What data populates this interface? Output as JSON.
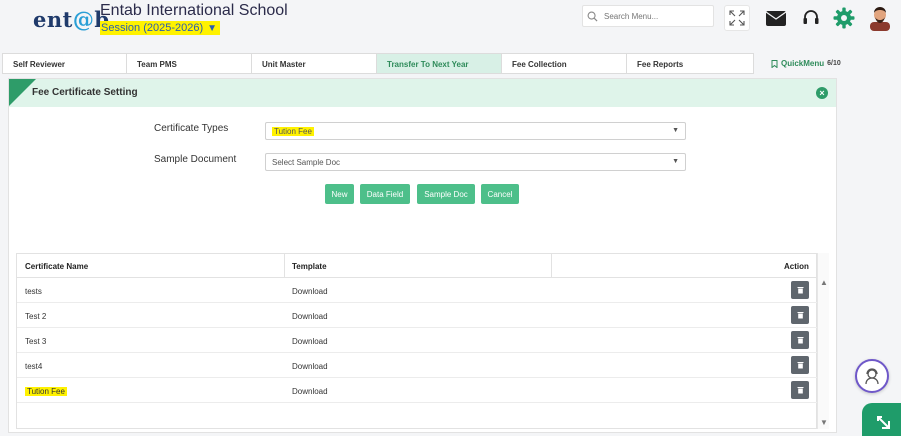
{
  "header": {
    "logo_main": "ent",
    "logo_at": "@",
    "logo_end": "b",
    "school_name": "Entab International School",
    "session": "Session (2025-2026)",
    "search_placeholder": "Search Menu..."
  },
  "tabs": [
    {
      "label": "Self Reviewer",
      "active": false
    },
    {
      "label": "Team PMS",
      "active": false
    },
    {
      "label": "Unit Master",
      "active": false
    },
    {
      "label": "Transfer To Next Year",
      "active": true
    },
    {
      "label": "Fee Collection",
      "active": false
    },
    {
      "label": "Fee Reports",
      "active": false
    }
  ],
  "quickmenu": {
    "label": "QuickMenu",
    "count": "6/10"
  },
  "panel": {
    "title": "Fee Certificate Setting"
  },
  "form": {
    "certificate_types_label": "Certificate Types",
    "certificate_types_value": "Tution Fee",
    "sample_document_label": "Sample Document",
    "sample_document_value": "Select Sample Doc"
  },
  "buttons": {
    "new": "New",
    "data_field": "Data Field",
    "sample_doc": "Sample Doc",
    "cancel": "Cancel"
  },
  "table": {
    "headers": {
      "name": "Certificate Name",
      "template": "Template",
      "action": "Action"
    },
    "rows": [
      {
        "name": "tests",
        "template": "Download"
      },
      {
        "name": "Test 2",
        "template": "Download"
      },
      {
        "name": "Test 3",
        "template": "Download"
      },
      {
        "name": "test4",
        "template": "Download"
      },
      {
        "name": "Tution Fee",
        "template": "Download"
      }
    ]
  },
  "colors": {
    "accent": "#2e9c69",
    "button": "#4dbf8a",
    "header_bg": "#dff4ea",
    "highlight": "#fff200"
  }
}
